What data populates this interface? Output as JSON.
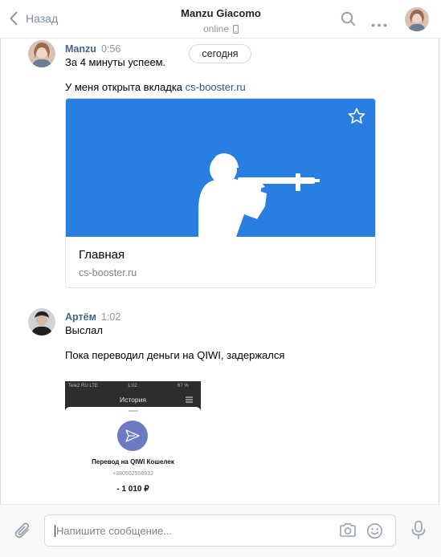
{
  "header": {
    "back_label": "Назад",
    "title": "Manzu Giacomo",
    "status": "online"
  },
  "date_divider": "сегодня",
  "messages": [
    {
      "author": "Manzu",
      "time": "0:56",
      "lines": [
        "За 4 минуты успеем."
      ],
      "text_prefix": "У меня открыта вкладка ",
      "link": "cs-booster.ru",
      "snippet": {
        "title": "Главная",
        "domain": "cs-booster.ru",
        "image_color": "#2a7de1"
      }
    },
    {
      "author": "Артём",
      "time": "1:02",
      "lines": [
        "Выслал",
        "Пока переводил деньги на QIWI, задержался"
      ],
      "attachment": {
        "carrier": "Tele2 RU  LTE",
        "clock": "1:02",
        "battery": "67 %",
        "header": "История",
        "transfer_title": "Перевод на QIWI Кошелек",
        "account": "+380502558932",
        "amount": "- 1 010 ₽"
      }
    }
  ],
  "composer": {
    "placeholder": "Напишите сообщение..."
  },
  "colors": {
    "accent": "#2a5885",
    "author": "#42648b",
    "icon": "#99a2ad"
  }
}
